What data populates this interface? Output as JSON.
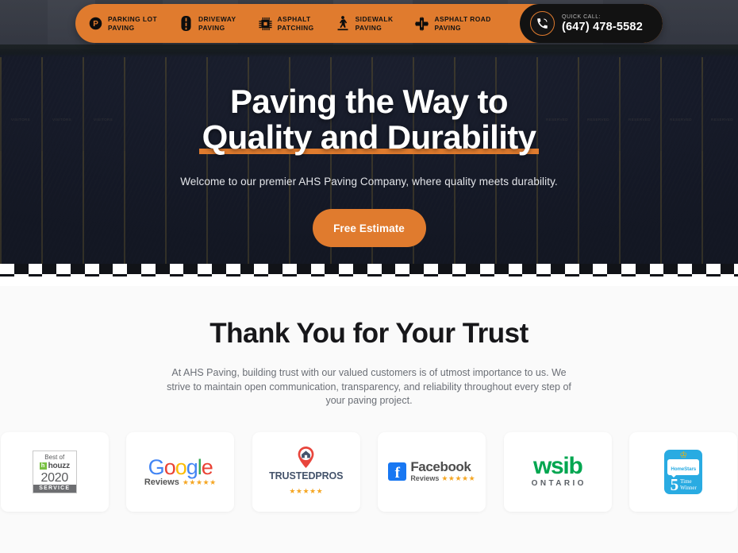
{
  "brand": {
    "accent": "#e07b2e",
    "dark": "#121212",
    "name": "AHS Paving"
  },
  "nav": {
    "items": [
      {
        "icon": "parking-circle-icon",
        "label": "PARKING LOT\nPAVING"
      },
      {
        "icon": "driveway-icon",
        "label": "DRIVEWAY\nPAVING"
      },
      {
        "icon": "asphalt-patch-icon",
        "label": "ASPHALT\nPATCHING"
      },
      {
        "icon": "pedestrian-icon",
        "label": "SIDEWALK\nPAVING"
      },
      {
        "icon": "road-cross-icon",
        "label": "ASPHALT ROAD\nPAVING"
      }
    ],
    "quick_call": {
      "label": "QUICK CALL:",
      "phone": "(647) 478-5582",
      "icon": "phone-icon"
    }
  },
  "hero": {
    "title_line1": "Paving the Way to",
    "title_line2": "Quality and Durability",
    "subtitle": "Welcome to our premier AHS Paving Company, where quality meets durability.",
    "cta_label": "Free Estimate",
    "stall_labels": [
      "VISITORS",
      "VISITORS",
      "VISITORS",
      "",
      "",
      "",
      "",
      "",
      "",
      "",
      "",
      "",
      "",
      "RESERVED",
      "RESERVED",
      "RESERVED",
      "RESERVED",
      "RESERVED"
    ]
  },
  "trust": {
    "heading": "Thank You for Your Trust",
    "paragraph": "At AHS Paving, building trust with our valued customers is of utmost importance to us. We strive to maintain open communication, transparency, and reliability throughout every step of your paving project.",
    "badges": [
      {
        "id": "houzz",
        "name": "best-of-houzz-badge",
        "best_of": "Best of",
        "brand": "houzz",
        "initial": "h",
        "year": "2020",
        "category": "SERVICE"
      },
      {
        "id": "google",
        "name": "google-reviews-badge",
        "letters": [
          "G",
          "o",
          "o",
          "g",
          "l",
          "e"
        ],
        "reviews_label": "Reviews",
        "stars": "★★★★★"
      },
      {
        "id": "trustedpros",
        "name": "trustedpros-badge",
        "brand": "TRUSTEDPROS",
        "stars": "★★★★★"
      },
      {
        "id": "facebook",
        "name": "facebook-reviews-badge",
        "mark": "f",
        "brand": "Facebook",
        "reviews_label": "Reviews",
        "stars": "★★★★★"
      },
      {
        "id": "wsib",
        "name": "wsib-ontario-badge",
        "brand": "wsib",
        "region": "ONTARIO"
      },
      {
        "id": "homestars",
        "name": "homestars-winner-badge",
        "brand": "HomeStars",
        "number": "5",
        "line1": "Time",
        "line2": "Winner"
      }
    ]
  }
}
